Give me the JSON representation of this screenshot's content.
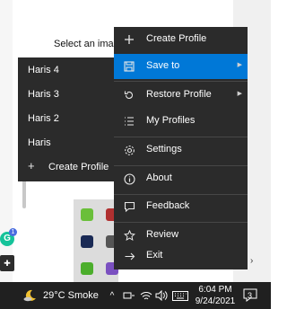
{
  "app": {
    "prompt_text": "Select an image"
  },
  "main_menu": {
    "items": [
      {
        "id": "create-profile",
        "label": "Create Profile",
        "icon": "plus-icon",
        "has_submenu": false
      },
      {
        "id": "save-to",
        "label": "Save to",
        "icon": "save-icon",
        "has_submenu": true,
        "highlighted": true
      },
      {
        "id": "restore-profile",
        "label": "Restore Profile",
        "icon": "restore-icon",
        "has_submenu": true
      },
      {
        "id": "my-profiles",
        "label": "My Profiles",
        "icon": "list-icon",
        "has_submenu": false
      },
      {
        "id": "settings",
        "label": "Settings",
        "icon": "gear-icon",
        "has_submenu": false
      },
      {
        "id": "about",
        "label": "About",
        "icon": "info-icon",
        "has_submenu": false
      },
      {
        "id": "feedback",
        "label": "Feedback",
        "icon": "feedback-icon",
        "has_submenu": false
      },
      {
        "id": "review",
        "label": "Review",
        "icon": "star-icon",
        "has_submenu": false
      },
      {
        "id": "exit",
        "label": "Exit",
        "icon": "exit-arrow-icon",
        "has_submenu": false
      }
    ]
  },
  "submenu": {
    "items": [
      "Haris 4",
      "Haris 3",
      "Haris 2",
      "Haris"
    ],
    "create_label": "Create Profile"
  },
  "taskbar": {
    "weather": "29°C  Smoke",
    "time": "6:04 PM",
    "date": "9/24/2021",
    "notification_count": "3"
  },
  "colors": {
    "menu_bg": "#2b2b2b",
    "highlight": "#0078d7",
    "taskbar_bg": "#202020"
  }
}
